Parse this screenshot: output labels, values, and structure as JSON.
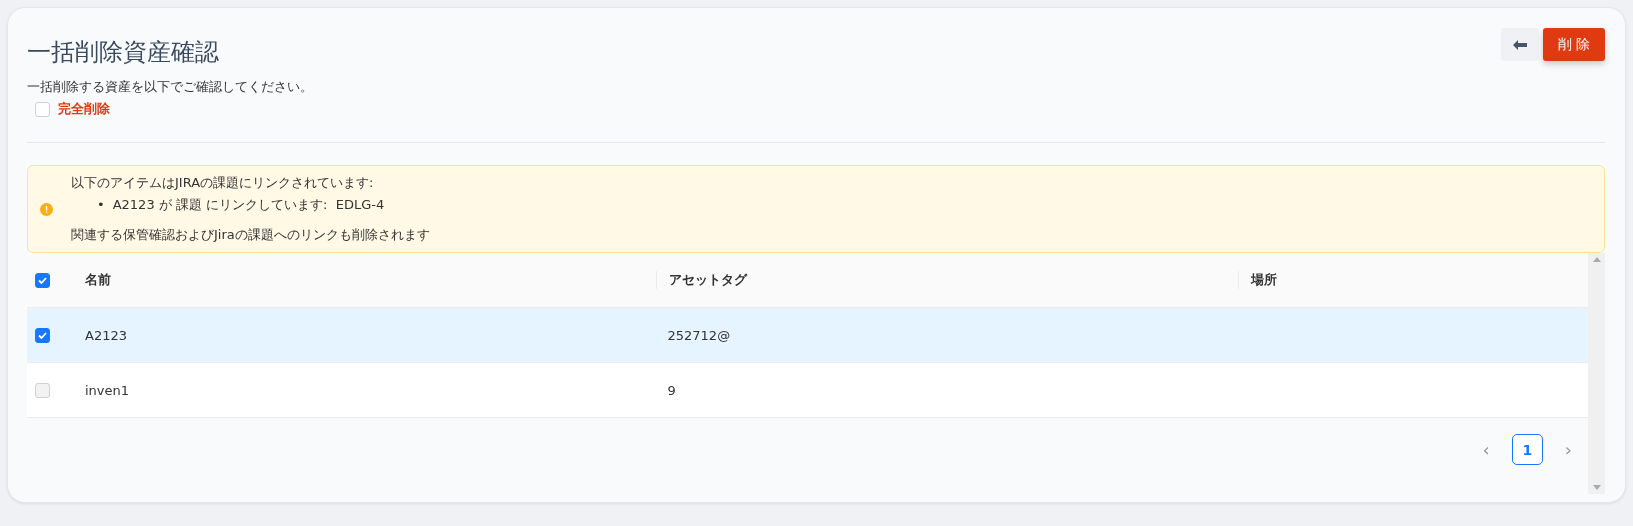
{
  "title": "一括削除資産確認",
  "delete_button": {
    "label": "削 除"
  },
  "description": "一括削除する資産を以下でご確認してください。",
  "permanent_delete": {
    "label": "完全削除",
    "checked": false
  },
  "alert": {
    "heading": "以下のアイテムはJIRAの課題にリンクされています:",
    "items": [
      {
        "bullet": "•",
        "text": "A2123 が 課題 にリンクしています:  EDLG-4"
      }
    ],
    "footer": "関連する保管確認およびJiraの課題へのリンクも削除されます"
  },
  "table": {
    "select_all": {
      "checked": true
    },
    "columns": [
      "名前",
      "アセットタグ",
      "場所"
    ],
    "rows": [
      {
        "cells": [
          "A2123",
          "252712@",
          ""
        ],
        "selected": true,
        "disabled": false
      },
      {
        "cells": [
          "inven1",
          "9",
          ""
        ],
        "selected": false,
        "disabled": true
      }
    ]
  },
  "pagination": {
    "previous": "‹",
    "pages": [
      {
        "label": "1",
        "selected": true
      }
    ],
    "next": "›"
  }
}
